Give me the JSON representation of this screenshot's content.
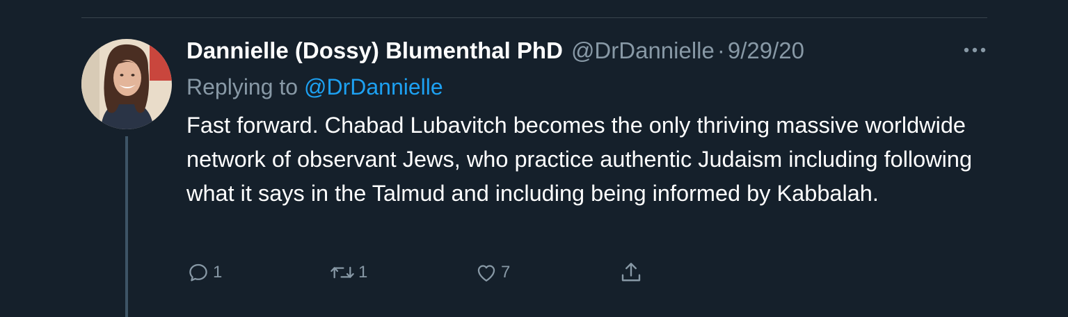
{
  "tweet": {
    "display_name": "Dannielle (Dossy) Blumenthal PhD",
    "handle": "@DrDannielle",
    "separator": "·",
    "timestamp": "9/29/20",
    "replying_prefix": "Replying to ",
    "replying_to": "@DrDannielle",
    "text": "Fast forward. Chabad Lubavitch becomes the only thriving massive worldwide network of observant Jews, who practice authentic Judaism including following what it says in the Talmud and including being informed by Kabbalah.",
    "avatar_icon": "profile-photo",
    "more_icon": "more-horizontal-icon"
  },
  "actions": {
    "reply": {
      "icon": "reply-icon",
      "count": "1"
    },
    "retweet": {
      "icon": "retweet-icon",
      "count": "1"
    },
    "like": {
      "icon": "heart-icon",
      "count": "7"
    },
    "share": {
      "icon": "share-icon"
    }
  },
  "colors": {
    "background": "#15202b",
    "text_primary": "#ffffff",
    "text_secondary": "#8899a6",
    "link": "#1da1f2",
    "divider": "#38444d",
    "thread_line": "#3d5466"
  }
}
